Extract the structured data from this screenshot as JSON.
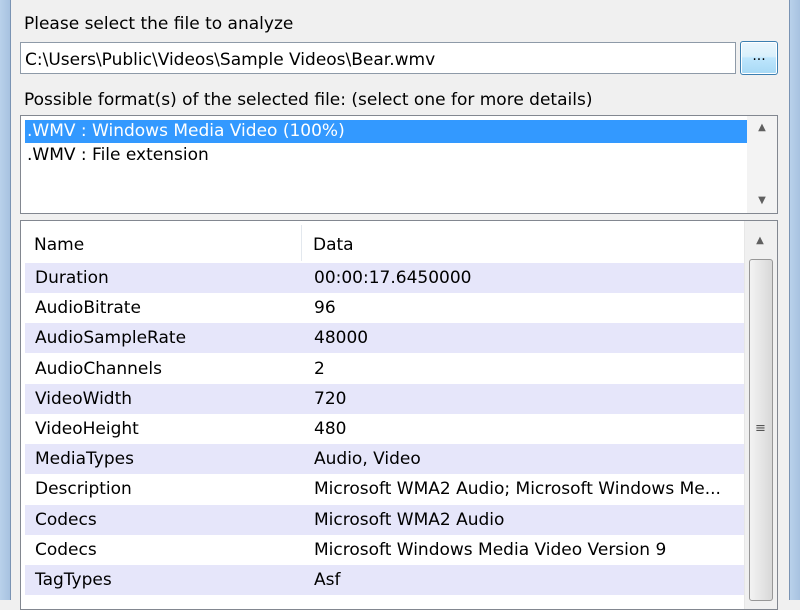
{
  "file_prompt": "Please select the file to analyze",
  "file_path": "C:\\Users\\Public\\Videos\\Sample Videos\\Bear.wmv",
  "browse_label": "...",
  "formats_prompt": "Possible format(s) of the selected file: (select one for more details)",
  "formats": [
    {
      "label": ".WMV : Windows Media Video (100%)",
      "selected": true
    },
    {
      "label": ".WMV : File extension",
      "selected": false
    }
  ],
  "grid": {
    "columns": [
      "Name",
      "Data"
    ],
    "rows": [
      {
        "name": "Duration",
        "data": "00:00:17.6450000"
      },
      {
        "name": "AudioBitrate",
        "data": "96"
      },
      {
        "name": "AudioSampleRate",
        "data": "48000"
      },
      {
        "name": "AudioChannels",
        "data": "2"
      },
      {
        "name": "VideoWidth",
        "data": "720"
      },
      {
        "name": "VideoHeight",
        "data": "480"
      },
      {
        "name": "MediaTypes",
        "data": "Audio, Video"
      },
      {
        "name": "Description",
        "data": "Microsoft WMA2 Audio; Microsoft Windows Me..."
      },
      {
        "name": "Codecs",
        "data": "Microsoft WMA2 Audio"
      },
      {
        "name": "Codecs",
        "data": "Microsoft Windows Media Video Version 9"
      },
      {
        "name": "TagTypes",
        "data": "Asf"
      }
    ]
  },
  "icons": {
    "scroll_up": "▲",
    "scroll_down": "▼",
    "grip": "≡"
  },
  "colors": {
    "selection": "#3399ff",
    "alt_row": "#e6e6fa"
  }
}
